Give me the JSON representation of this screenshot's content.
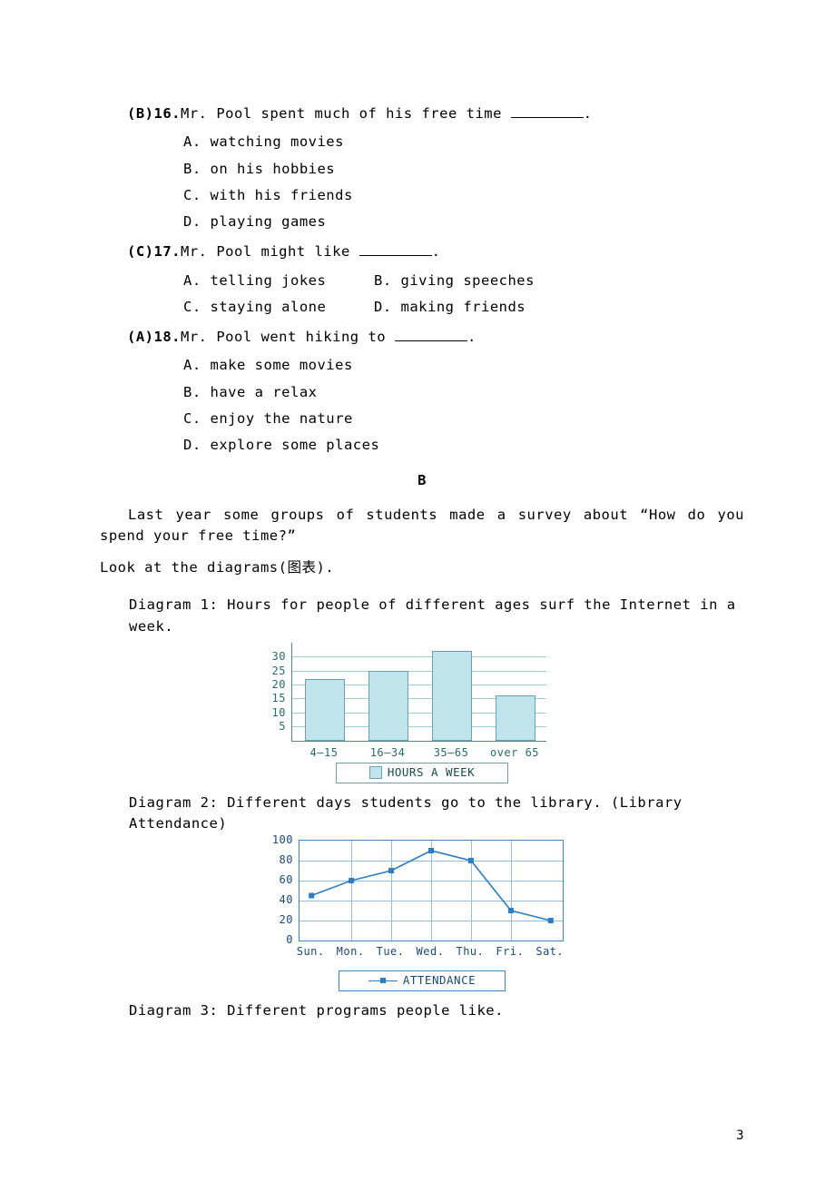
{
  "q16": {
    "prefix": "(B)16.",
    "stem_pre": "Mr. Pool spent much of his free time ",
    "stem_post": ".",
    "options": {
      "a": "A. watching movies",
      "b": "B. on his hobbies",
      "c": "C. with his friends",
      "d": "D. playing games"
    }
  },
  "q17": {
    "prefix": "(C)17.",
    "stem_pre": "Mr. Pool might like ",
    "stem_post": ".",
    "options": {
      "a": "A. telling jokes",
      "b": "B. giving speeches",
      "c": "C. staying alone",
      "d": "D. making friends"
    }
  },
  "q18": {
    "prefix": "(A)18.",
    "stem_pre": "Mr. Pool went hiking to ",
    "stem_post": ".",
    "options": {
      "a": "A. make some movies",
      "b": "B. have a relax",
      "c": "C. enjoy the nature",
      "d": "D. explore some places"
    }
  },
  "sectionB": "B",
  "passage_line1": "Last year some groups of students made a survey about “How do you spend your free time?”",
  "passage_line2": "Look at the diagrams(图表).",
  "diagram1_caption": "Diagram 1: Hours for people of different ages surf the Internet in a week.",
  "diagram2_caption": "Diagram 2: Different days students go to the library. (Library Attendance)",
  "diagram3_caption": "Diagram 3: Different programs people like.",
  "page_number": "3",
  "chart_data": [
    {
      "type": "bar",
      "legend": "HOURS A WEEK",
      "categories": [
        "4–15",
        "16–34",
        "35–65",
        "over 65"
      ],
      "values": [
        22,
        25,
        32,
        16
      ],
      "ylim": [
        0,
        35
      ],
      "yticks": [
        5,
        10,
        15,
        20,
        25,
        30
      ]
    },
    {
      "type": "line",
      "legend": "ATTENDANCE",
      "categories": [
        "Sun.",
        "Mon.",
        "Tue.",
        "Wed.",
        "Thu.",
        "Fri.",
        "Sat."
      ],
      "values": [
        45,
        60,
        70,
        90,
        80,
        30,
        20
      ],
      "ylim": [
        0,
        100
      ],
      "yticks": [
        0,
        20,
        40,
        60,
        80,
        100
      ]
    }
  ]
}
